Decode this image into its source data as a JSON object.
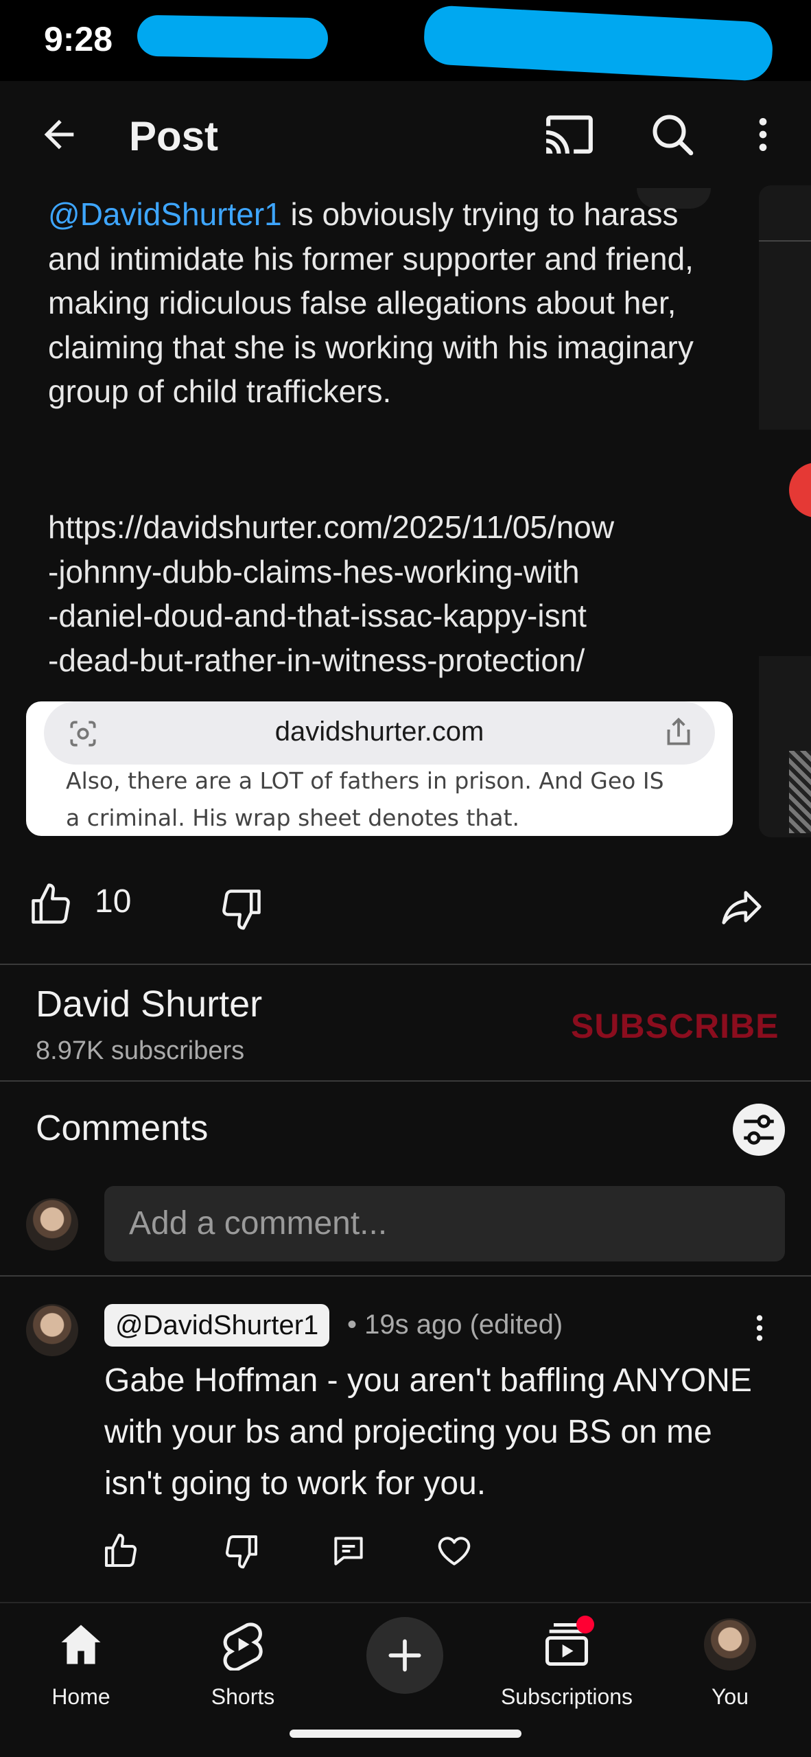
{
  "status_bar": {
    "time": "9:28"
  },
  "app_bar": {
    "title": "Post",
    "icons": [
      "back-arrow-icon",
      "cast-icon",
      "search-icon",
      "more-vertical-icon"
    ]
  },
  "post": {
    "mention": "@DavidShurter1",
    "text": " is obviously trying to harass and intimidate his former supporter and friend, making ridiculous false allegations about her, claiming that she is working with his imaginary group of child traffickers.",
    "link_lines": [
      "https://davidshurter.com/2025/11/05/now",
      "-johnny-dubb-claims-hes-working-with",
      "-daniel-doud-and-that-issac-kappy-isnt",
      "-dead-but-rather-in-witness-protection/"
    ],
    "screenshot": {
      "url": "davidshurter.com",
      "cut_line": "Also, there are a LOT of fathers in prison. And Geo IS",
      "line": "a criminal. His wrap sheet denotes that."
    },
    "like_count": "10"
  },
  "channel": {
    "name": "David Shurter",
    "subscribers": "8.97K subscribers",
    "subscribe_label": "SUBSCRIBE",
    "subscribe_color": "#8b0d1e"
  },
  "comments": {
    "title": "Comments",
    "input_placeholder": "Add a comment...",
    "items": [
      {
        "author": "@DavidShurter1",
        "meta": "• 19s ago (edited)",
        "body": "Gabe Hoffman - you aren't baffling ANYONE with your bs and projecting you BS on me isn't going to work for you."
      }
    ]
  },
  "bottom_nav": {
    "items": [
      {
        "label": "Home",
        "icon": "home-icon"
      },
      {
        "label": "Shorts",
        "icon": "shorts-icon"
      },
      {
        "label": "",
        "icon": "create-plus-icon"
      },
      {
        "label": "Subscriptions",
        "icon": "subscriptions-icon"
      },
      {
        "label": "You",
        "icon": "avatar"
      }
    ]
  },
  "colors": {
    "background": "#0f0f0f",
    "mention": "#3ea6ff",
    "redaction": "#00a8f0",
    "notification_dot": "#ff0033"
  }
}
